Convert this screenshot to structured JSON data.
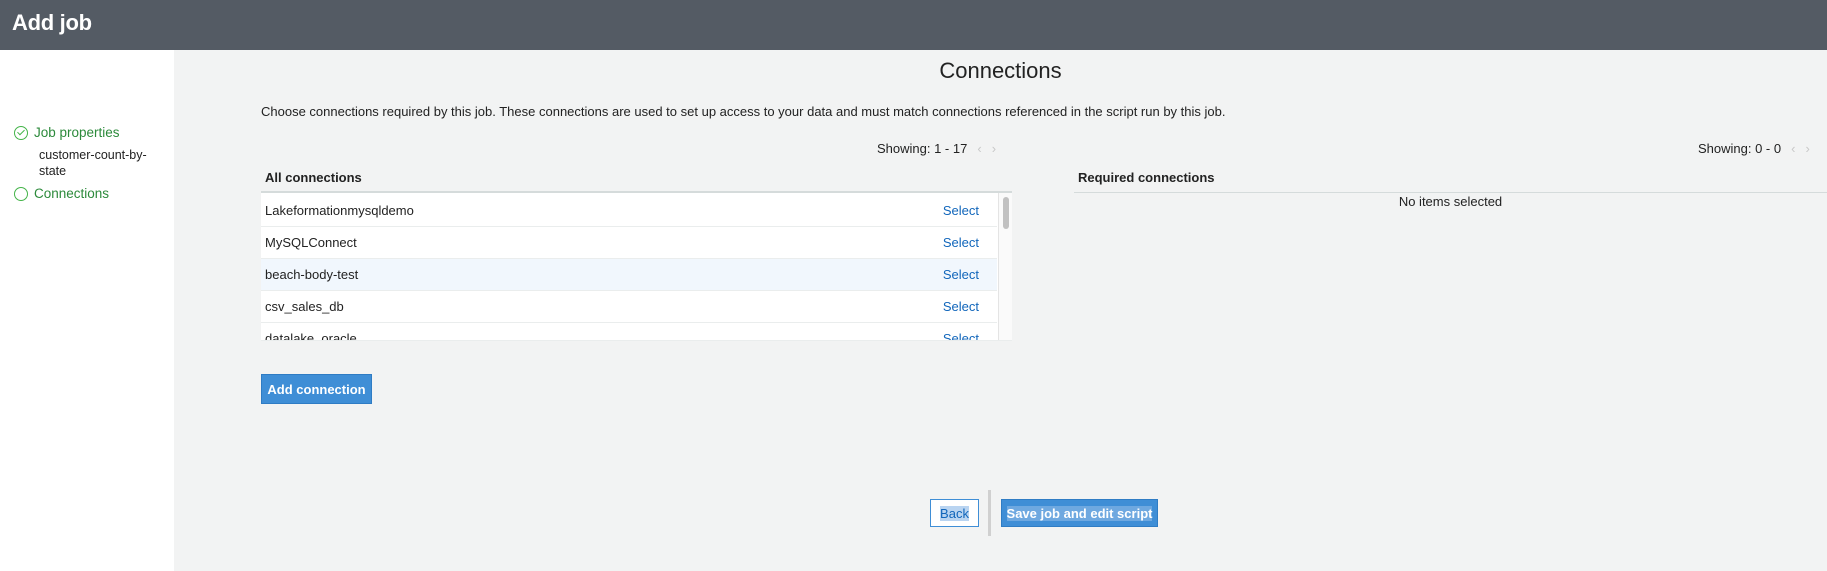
{
  "header": {
    "title": "Add job"
  },
  "sidebar": {
    "steps": [
      {
        "label": "Job properties",
        "sub": "customer-count-by-state",
        "icon": "check-circle-icon"
      },
      {
        "label": "Connections",
        "icon": "circle-icon"
      }
    ]
  },
  "main": {
    "title": "Connections",
    "description": "Choose connections required by this job. These connections are used to set up access to your data and must match connections referenced in the script run by this job.",
    "all_connections": {
      "header": "All connections",
      "showing": "Showing: 1 - 17",
      "rows": [
        {
          "name": "Lakeformationmysqldemo",
          "action": "Select"
        },
        {
          "name": "MySQLConnect",
          "action": "Select"
        },
        {
          "name": "beach-body-test",
          "action": "Select"
        },
        {
          "name": "csv_sales_db",
          "action": "Select"
        },
        {
          "name": "datalake_oracle",
          "action": "Select"
        }
      ]
    },
    "required_connections": {
      "header": "Required connections",
      "showing": "Showing: 0 - 0",
      "empty_text": "No items selected"
    },
    "add_connection_label": "Add connection"
  },
  "footer": {
    "back_label": "Back",
    "save_label": "Save job and edit script"
  },
  "colors": {
    "header_bg": "#545b64",
    "accent": "#3f8ed6",
    "step_green": "#44b449",
    "link": "#1166bb"
  }
}
